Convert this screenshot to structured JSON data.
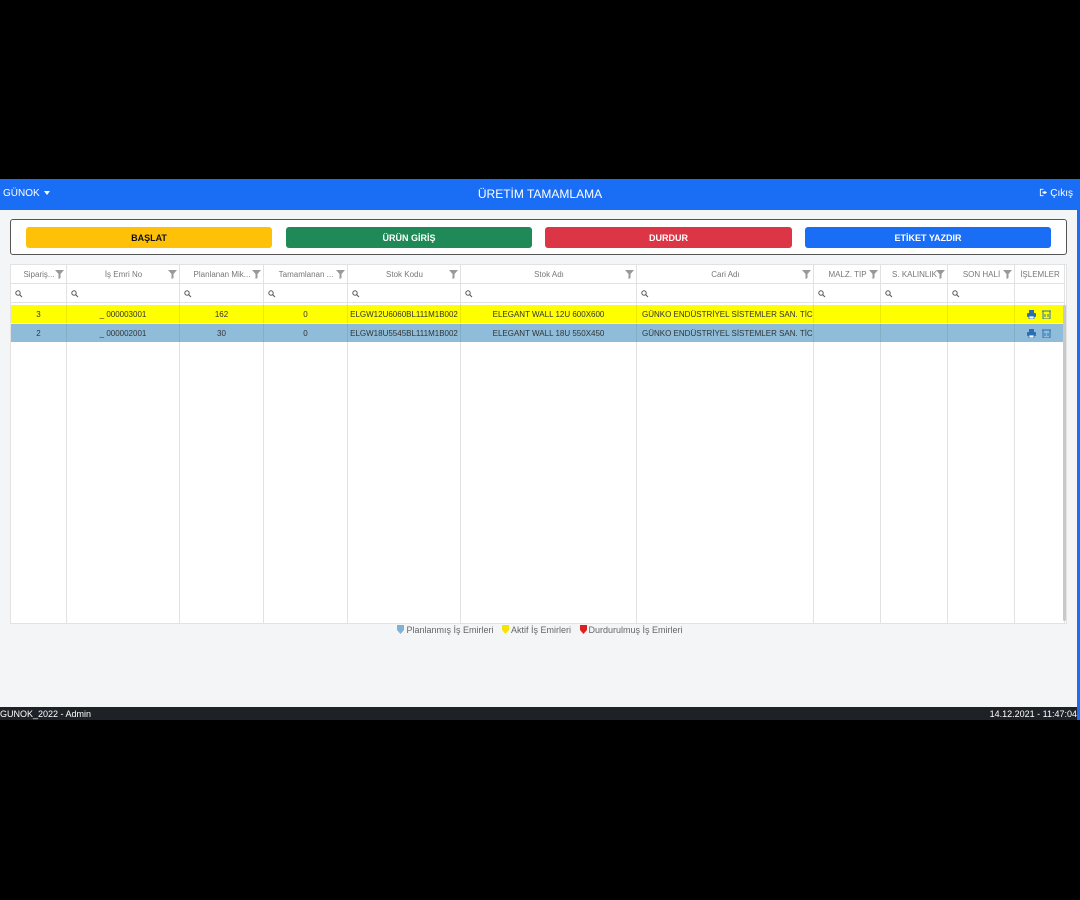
{
  "navbar": {
    "brand": "GÜNOK",
    "title": "ÜRETİM TAMAMLAMA",
    "logout": "Çıkış"
  },
  "actions": {
    "start": "BAŞLAT",
    "product_entry": "ÜRÜN GİRİŞ",
    "stop": "DURDUR",
    "print_label": "ETİKET YAZDIR"
  },
  "colors": {
    "primary": "#1a6ef5",
    "warning": "#ffc107",
    "success": "#1f8a57",
    "danger": "#dc3545",
    "active_row": "#ffff00",
    "planned_row": "#8fbdd9"
  },
  "table": {
    "columns": [
      "Sipariş...",
      "İş Emri No",
      "Planlanan Mik...",
      "Tamamlanan ...",
      "Stok Kodu",
      "Stok Adı",
      "Cari Adı",
      "MALZ. TIP",
      "S. KALINLIK",
      "SON HALİ",
      "İŞLEMLER"
    ],
    "rows": [
      {
        "status": "active",
        "cells": [
          "3",
          "_ 000003001",
          "162",
          "0",
          "ELGW12U6060BL111M1B002",
          "ELEGANT WALL 12U 600X600",
          "GÜNKO ENDÜSTRİYEL SİSTEMLER SAN. TİC. LT...",
          "",
          "",
          ""
        ]
      },
      {
        "status": "planned",
        "cells": [
          "2",
          "_ 000002001",
          "30",
          "0",
          "ELGW18U5545BL111M1B002",
          "ELEGANT WALL 18U 550X450",
          "GÜNKO ENDÜSTRİYEL SİSTEMLER SAN. TİC. LT...",
          "",
          "",
          ""
        ]
      }
    ],
    "row_icons": [
      "print-icon",
      "delete-icon"
    ]
  },
  "legend": {
    "planned": "Planlanmış İş Emirleri",
    "active": "Aktif İş Emirleri",
    "stopped": "Durdurulmuş İş Emirleri",
    "planned_color": "#7fb3d5",
    "active_color": "#f5e400",
    "stopped_color": "#dc1f1f"
  },
  "statusbar": {
    "left": "GUNOK_2022 - Admin",
    "right": "14.12.2021 - 11:47:04"
  }
}
